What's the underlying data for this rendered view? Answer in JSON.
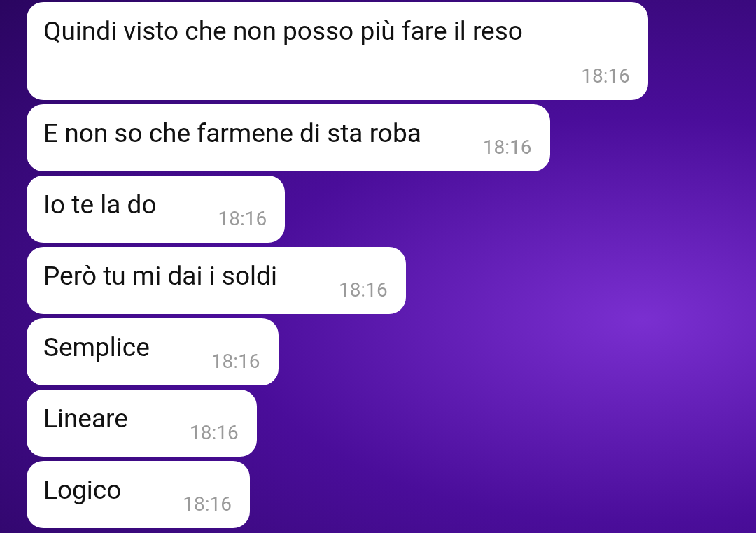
{
  "messages": [
    {
      "text": "Quindi visto che non posso più fare il reso",
      "time": "18:16"
    },
    {
      "text": "E non so che farmene di sta roba",
      "time": "18:16"
    },
    {
      "text": "Io te la do",
      "time": "18:16"
    },
    {
      "text": "Però tu mi dai i soldi",
      "time": "18:16"
    },
    {
      "text": "Semplice",
      "time": "18:16"
    },
    {
      "text": "Lineare",
      "time": "18:16"
    },
    {
      "text": "Logico",
      "time": "18:16"
    }
  ]
}
